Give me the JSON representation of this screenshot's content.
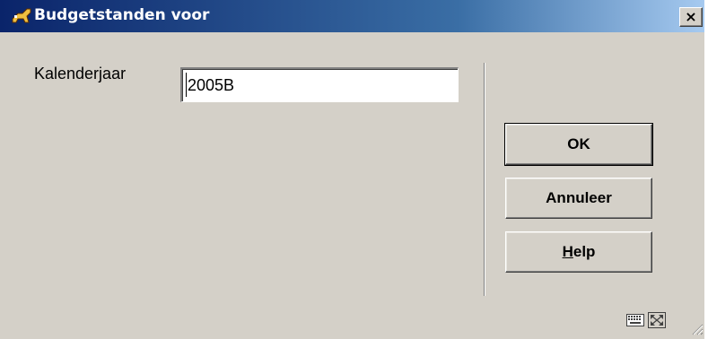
{
  "window": {
    "title": "Budgetstanden voor",
    "close_label": "×"
  },
  "form": {
    "year_label": "Kalenderjaar",
    "year_value": "2005B"
  },
  "buttons": {
    "ok": "OK",
    "cancel": "Annuleer",
    "help_first": "H",
    "help_rest": "elp"
  },
  "status_bar": {
    "icons": [
      "keyboard-icon",
      "maximize-icon",
      "resize-grip-icon"
    ]
  },
  "colors": {
    "title_start": "#0a246a",
    "title_end": "#a6caf0",
    "face": "#d4d0c8"
  }
}
